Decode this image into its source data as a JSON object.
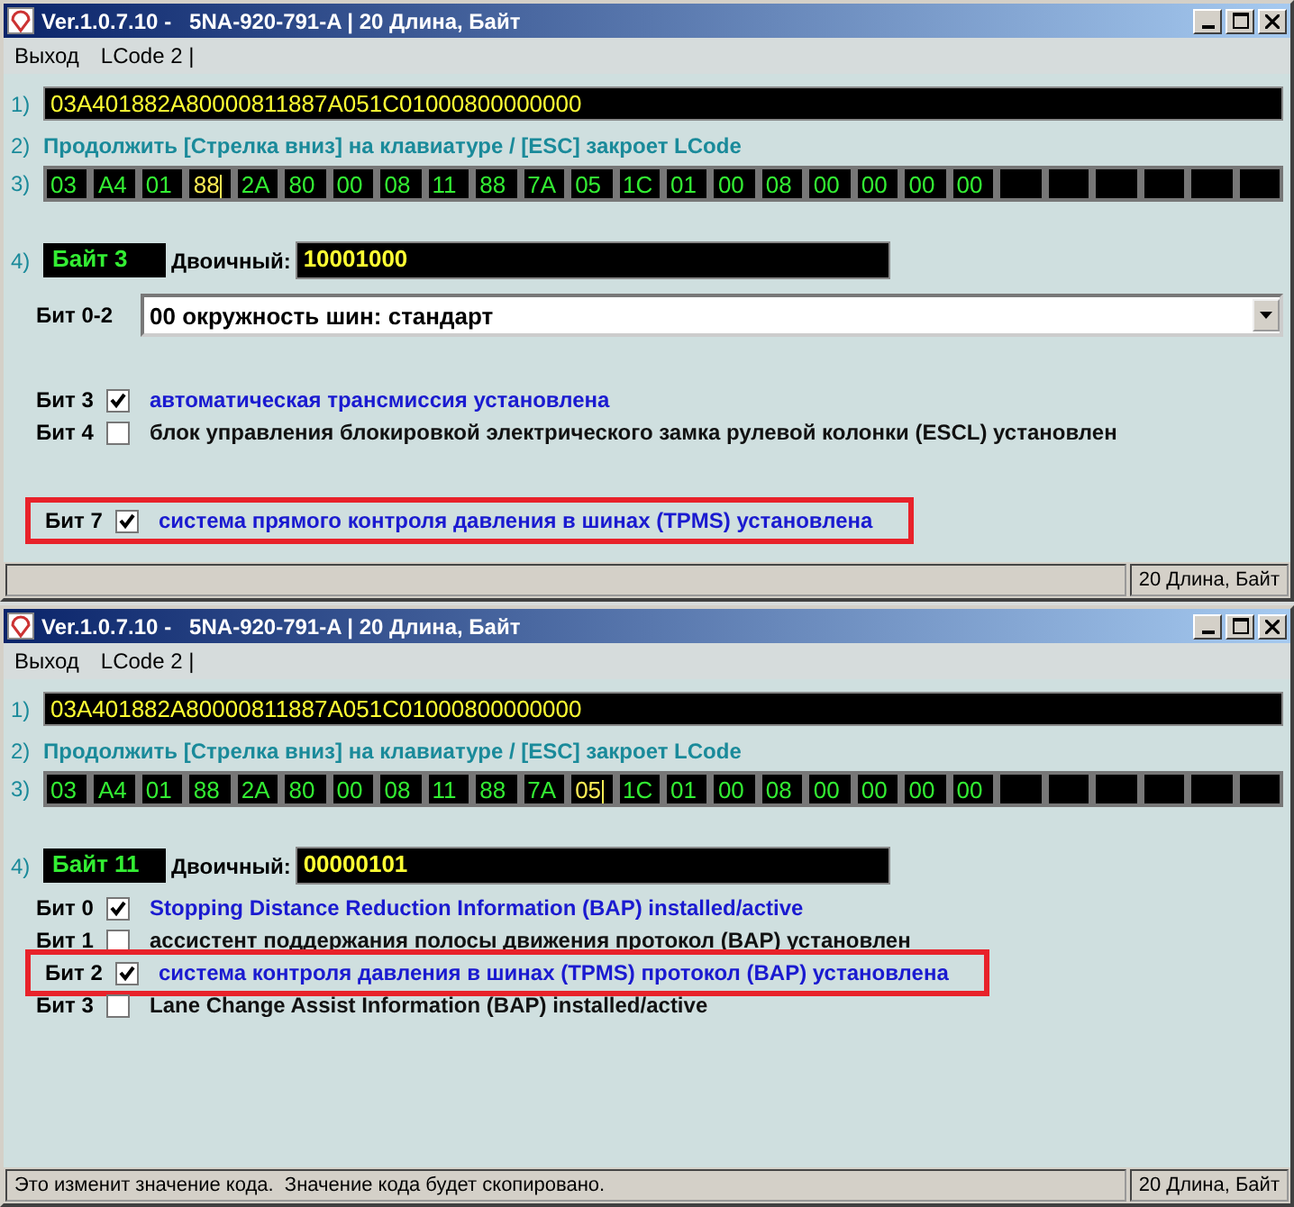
{
  "windows": [
    {
      "title": "Ver.1.0.7.10 -   5NA-920-791-A | 20 Длина, Байт",
      "menu": [
        "Выход",
        "LCode 2 |"
      ],
      "code_row": {
        "label": "1)",
        "value": "03A401882A80000811887A051C01000800000000"
      },
      "hint_row": {
        "label": "2)",
        "text": "Продолжить [Стрелка вниз] на клавиатуре / [ESC] закроет LCode"
      },
      "bytes_row": {
        "label": "3)",
        "bytes": [
          {
            "value": "03",
            "selected": false
          },
          {
            "value": "A4",
            "selected": false
          },
          {
            "value": "01",
            "selected": false
          },
          {
            "value": "88",
            "selected": true
          },
          {
            "value": "2A",
            "selected": false
          },
          {
            "value": "80",
            "selected": false
          },
          {
            "value": "00",
            "selected": false
          },
          {
            "value": "08",
            "selected": false
          },
          {
            "value": "11",
            "selected": false
          },
          {
            "value": "88",
            "selected": false
          },
          {
            "value": "7A",
            "selected": false
          },
          {
            "value": "05",
            "selected": false
          },
          {
            "value": "1C",
            "selected": false
          },
          {
            "value": "01",
            "selected": false
          },
          {
            "value": "00",
            "selected": false
          },
          {
            "value": "08",
            "selected": false
          },
          {
            "value": "00",
            "selected": false
          },
          {
            "value": "00",
            "selected": false
          },
          {
            "value": "00",
            "selected": false
          },
          {
            "value": "00",
            "selected": false
          }
        ]
      },
      "byte_row": {
        "label": "4)",
        "byte_name": "Байт 3",
        "binary_label": "Двоичный:",
        "binary_value": "10001000"
      },
      "dropdown": {
        "label": "Бит 0-2",
        "value": "00 окружность шин: стандарт"
      },
      "bits": [
        {
          "label": "Бит 3",
          "checked": true,
          "text": "автоматическая трансмиссия установлена",
          "highlighted": false
        },
        {
          "label": "Бит 4",
          "checked": false,
          "text": "блок управления блокировкой электрического замка рулевой колонки (ESCL) установлен",
          "highlighted": false
        },
        {
          "label": "Бит 7",
          "checked": true,
          "text": "система прямого контроля давления в шинах (TPMS) установлена",
          "highlighted": true
        }
      ],
      "status": {
        "length": "20 Длина, Байт"
      }
    },
    {
      "title": "Ver.1.0.7.10 -   5NA-920-791-A | 20 Длина, Байт",
      "menu": [
        "Выход",
        "LCode 2 |"
      ],
      "code_row": {
        "label": "1)",
        "value": "03A401882A80000811887A051C01000800000000"
      },
      "hint_row": {
        "label": "2)",
        "text": "Продолжить [Стрелка вниз] на клавиатуре / [ESC] закроет LCode"
      },
      "bytes_row": {
        "label": "3)",
        "bytes": [
          {
            "value": "03",
            "selected": false
          },
          {
            "value": "A4",
            "selected": false
          },
          {
            "value": "01",
            "selected": false
          },
          {
            "value": "88",
            "selected": false
          },
          {
            "value": "2A",
            "selected": false
          },
          {
            "value": "80",
            "selected": false
          },
          {
            "value": "00",
            "selected": false
          },
          {
            "value": "08",
            "selected": false
          },
          {
            "value": "11",
            "selected": false
          },
          {
            "value": "88",
            "selected": false
          },
          {
            "value": "7A",
            "selected": false
          },
          {
            "value": "05",
            "selected": true
          },
          {
            "value": "1C",
            "selected": false
          },
          {
            "value": "01",
            "selected": false
          },
          {
            "value": "00",
            "selected": false
          },
          {
            "value": "08",
            "selected": false
          },
          {
            "value": "00",
            "selected": false
          },
          {
            "value": "00",
            "selected": false
          },
          {
            "value": "00",
            "selected": false
          },
          {
            "value": "00",
            "selected": false
          }
        ]
      },
      "byte_row": {
        "label": "4)",
        "byte_name": "Байт 11",
        "binary_label": "Двоичный:",
        "binary_value": "00000101"
      },
      "bits": [
        {
          "label": "Бит 0",
          "checked": true,
          "text": "Stopping Distance Reduction Information (BAP) installed/active",
          "highlighted": false
        },
        {
          "label": "Бит 1",
          "checked": false,
          "text": "ассистент поддержания полосы движения протокол (BAP) установлен",
          "highlighted": false
        },
        {
          "label": "Бит 2",
          "checked": true,
          "text": "система контроля давления в шинах (TPMS) протокол (BAP) установлена",
          "highlighted": true
        },
        {
          "label": "Бит 3",
          "checked": false,
          "text": "Lane Change Assist Information (BAP) installed/active",
          "highlighted": false
        }
      ],
      "status": {
        "message": "Это изменит значение кода.  Значение кода будет скопировано.",
        "length": "20 Длина, Байт"
      }
    }
  ]
}
